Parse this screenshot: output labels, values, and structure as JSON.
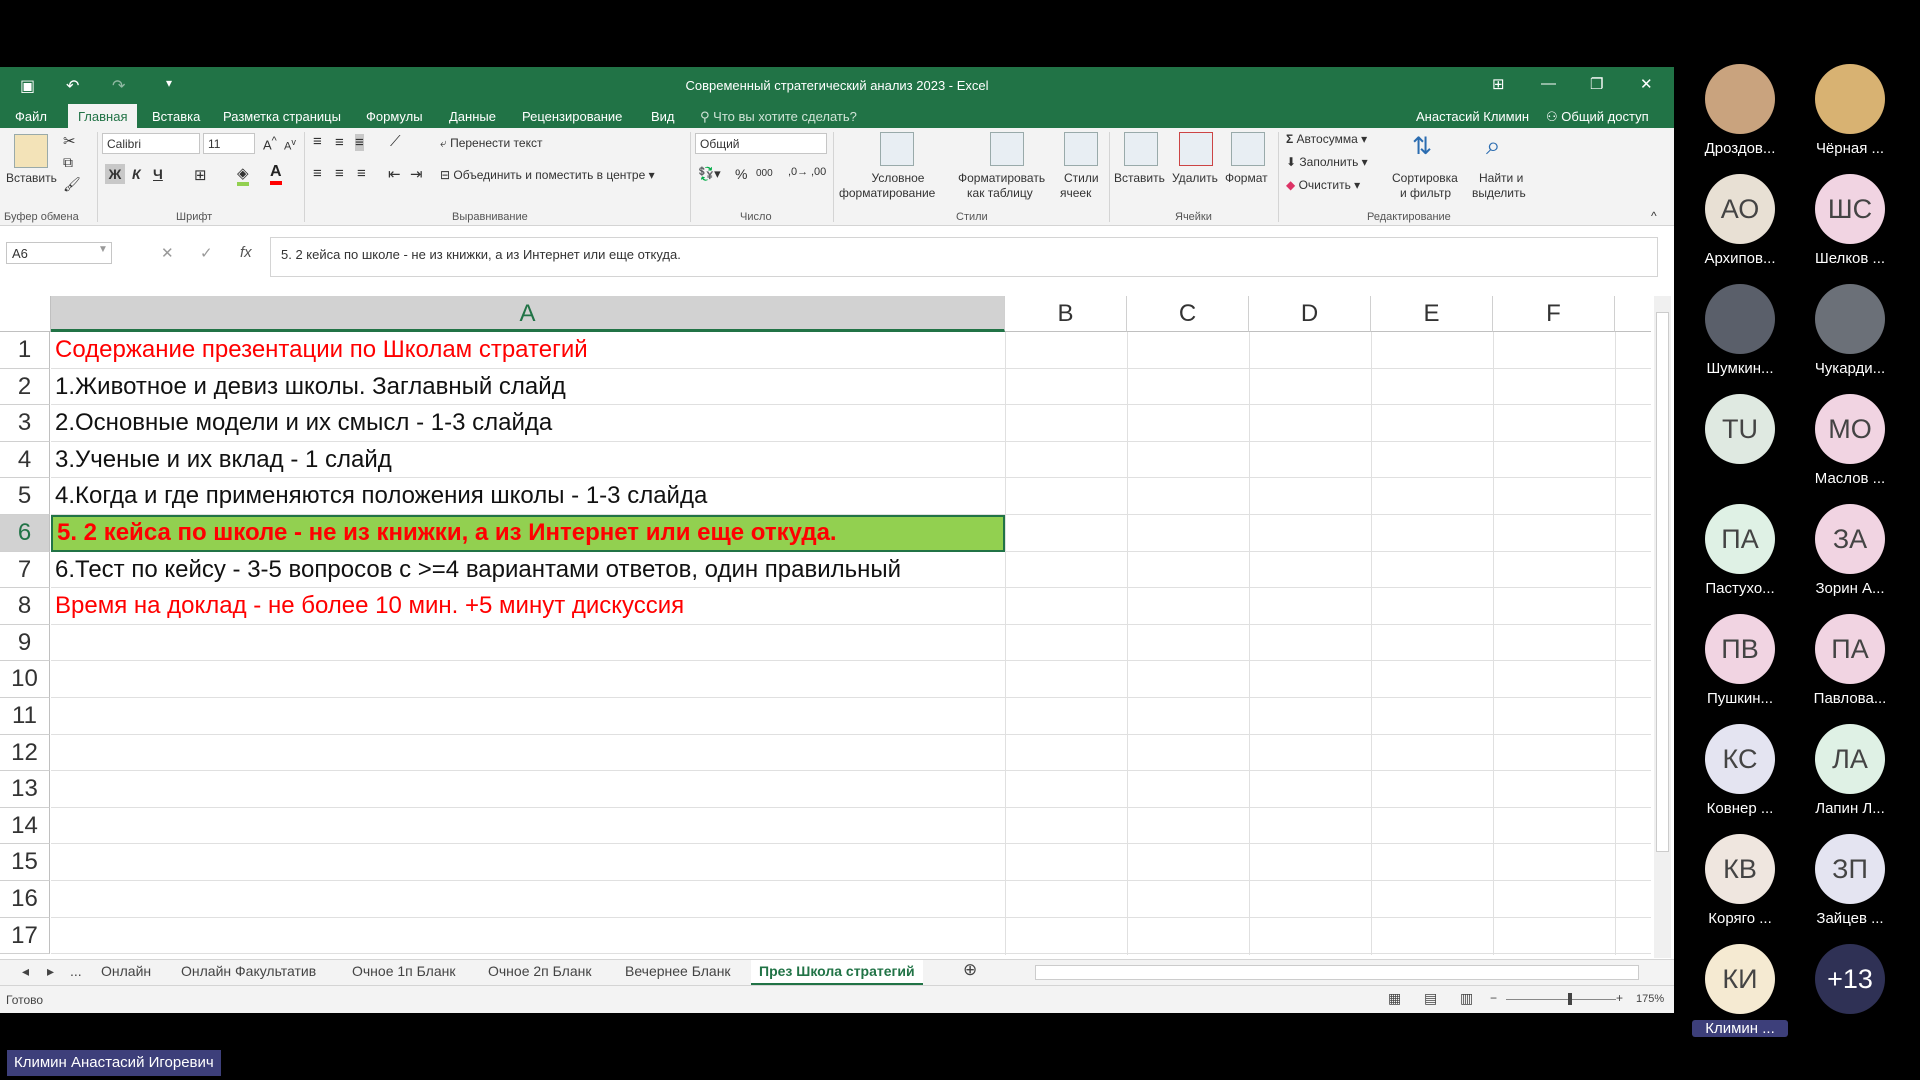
{
  "window": {
    "title": "Современный стратегический анализ 2023 - Excel",
    "user": "Анастасий Климин",
    "share": "Общий доступ",
    "tell_me": "Что вы хотите сделать?"
  },
  "ribbon_tabs": [
    "Файл",
    "Главная",
    "Вставка",
    "Разметка страницы",
    "Формулы",
    "Данные",
    "Рецензирование",
    "Вид"
  ],
  "ribbon": {
    "paste": "Вставить",
    "clipboard": "Буфер обмена",
    "font_name": "Calibri",
    "font_size": "11",
    "font_group": "Шрифт",
    "bold": "Ж",
    "italic": "К",
    "underline": "Ч",
    "wrap_text": "Перенести текст",
    "merge_center": "Объединить и поместить в центре",
    "alignment_group": "Выравнивание",
    "number_format": "Общий",
    "number_group": "Число",
    "cond_format_1": "Условное",
    "cond_format_2": "форматирование",
    "format_table_1": "Форматировать",
    "format_table_2": "как таблицу",
    "cell_styles_1": "Стили",
    "cell_styles_2": "ячеек",
    "styles_group": "Стили",
    "insert": "Вставить",
    "delete": "Удалить",
    "format": "Формат",
    "cells_group": "Ячейки",
    "autosum": "Автосумма",
    "fill": "Заполнить",
    "clear": "Очистить",
    "sort_1": "Сортировка",
    "sort_2": "и фильтр",
    "find_1": "Найти и",
    "find_2": "выделить",
    "editing_group": "Редактирование"
  },
  "formula_bar": {
    "name_box": "A6",
    "formula": "5. 2 кейса по школе - не из книжки, а из Интернет или еще откуда."
  },
  "columns": [
    "A",
    "B",
    "C",
    "D",
    "E",
    "F"
  ],
  "rows": [
    "1",
    "2",
    "3",
    "4",
    "5",
    "6",
    "7",
    "8",
    "9",
    "10",
    "11",
    "12",
    "13",
    "14",
    "15",
    "16",
    "17"
  ],
  "cells": [
    {
      "text": "Содержание презентации по Школам стратегий",
      "color": "#ff0000",
      "bold": false
    },
    {
      "text": "1.Животное и девиз школы. Заглавный слайд",
      "color": "#111111",
      "bold": false
    },
    {
      "text": "2.Основные модели и их смысл - 1-3 слайда",
      "color": "#111111",
      "bold": false
    },
    {
      "text": "3.Ученые и их вклад - 1 слайд",
      "color": "#111111",
      "bold": false
    },
    {
      "text": "4.Когда и где применяются положения школы - 1-3 слайда",
      "color": "#111111",
      "bold": false
    },
    {
      "text": "5. 2 кейса по школе - не из книжки, а из Интернет или еще откуда.",
      "color": "#ff0000",
      "bold": true,
      "fill": "#92d050"
    },
    {
      "text": "6.Тест по кейсу - 3-5 вопросов с >=4 вариантами ответов, один правильный",
      "color": "#111111",
      "bold": false
    },
    {
      "text": "Время на доклад -  не более 10 мин. +5 минут дискуссия",
      "color": "#ff0000",
      "bold": false
    }
  ],
  "sheet_tabs": [
    "...",
    "Онлайн",
    "Онлайн Факультатив",
    "Очное 1п Бланк",
    "Очное 2п Бланк",
    "Вечернее Бланк",
    "През Школа стратегий"
  ],
  "status": {
    "ready": "Готово",
    "zoom": "175%"
  },
  "participants": [
    {
      "initials": "",
      "name": "Дроздов...",
      "color": "#c9a37e"
    },
    {
      "initials": "",
      "name": "Чёрная ...",
      "color": "#d8b272"
    },
    {
      "initials": "АО",
      "name": "Архипов...",
      "color": "#e8e0d4"
    },
    {
      "initials": "ШС",
      "name": "Шелков ...",
      "color": "#f1d4e2"
    },
    {
      "initials": "",
      "name": "Шумкин...",
      "color": "#5a5f6a"
    },
    {
      "initials": "",
      "name": "Чукарди...",
      "color": "#6b7078"
    },
    {
      "initials": "TU",
      "name": "",
      "color": "#dfe9e1"
    },
    {
      "initials": "МО",
      "name": "Маслов ...",
      "color": "#f1d4e2"
    },
    {
      "initials": "ПА",
      "name": "Пастухо...",
      "color": "#dff1e5"
    },
    {
      "initials": "ЗА",
      "name": "Зорин А...",
      "color": "#f1d4e2"
    },
    {
      "initials": "ПВ",
      "name": "Пушкин...",
      "color": "#f1d4e2"
    },
    {
      "initials": "ПА",
      "name": "Павлова...",
      "color": "#f1d4e2"
    },
    {
      "initials": "КС",
      "name": "Ковнер ...",
      "color": "#e4e4f1"
    },
    {
      "initials": "ЛА",
      "name": "Лапин Л...",
      "color": "#dff1e5"
    },
    {
      "initials": "КВ",
      "name": "Коряго ...",
      "color": "#efe6df"
    },
    {
      "initials": "ЗП",
      "name": "Зайцев ...",
      "color": "#e4e4f1"
    },
    {
      "initials": "КИ",
      "name": "Климин ...",
      "color": "#f5ead2"
    },
    {
      "initials": "+13",
      "name": "",
      "color": "#2f3155"
    }
  ],
  "speaker": "Климин Анастасий Игоревич"
}
